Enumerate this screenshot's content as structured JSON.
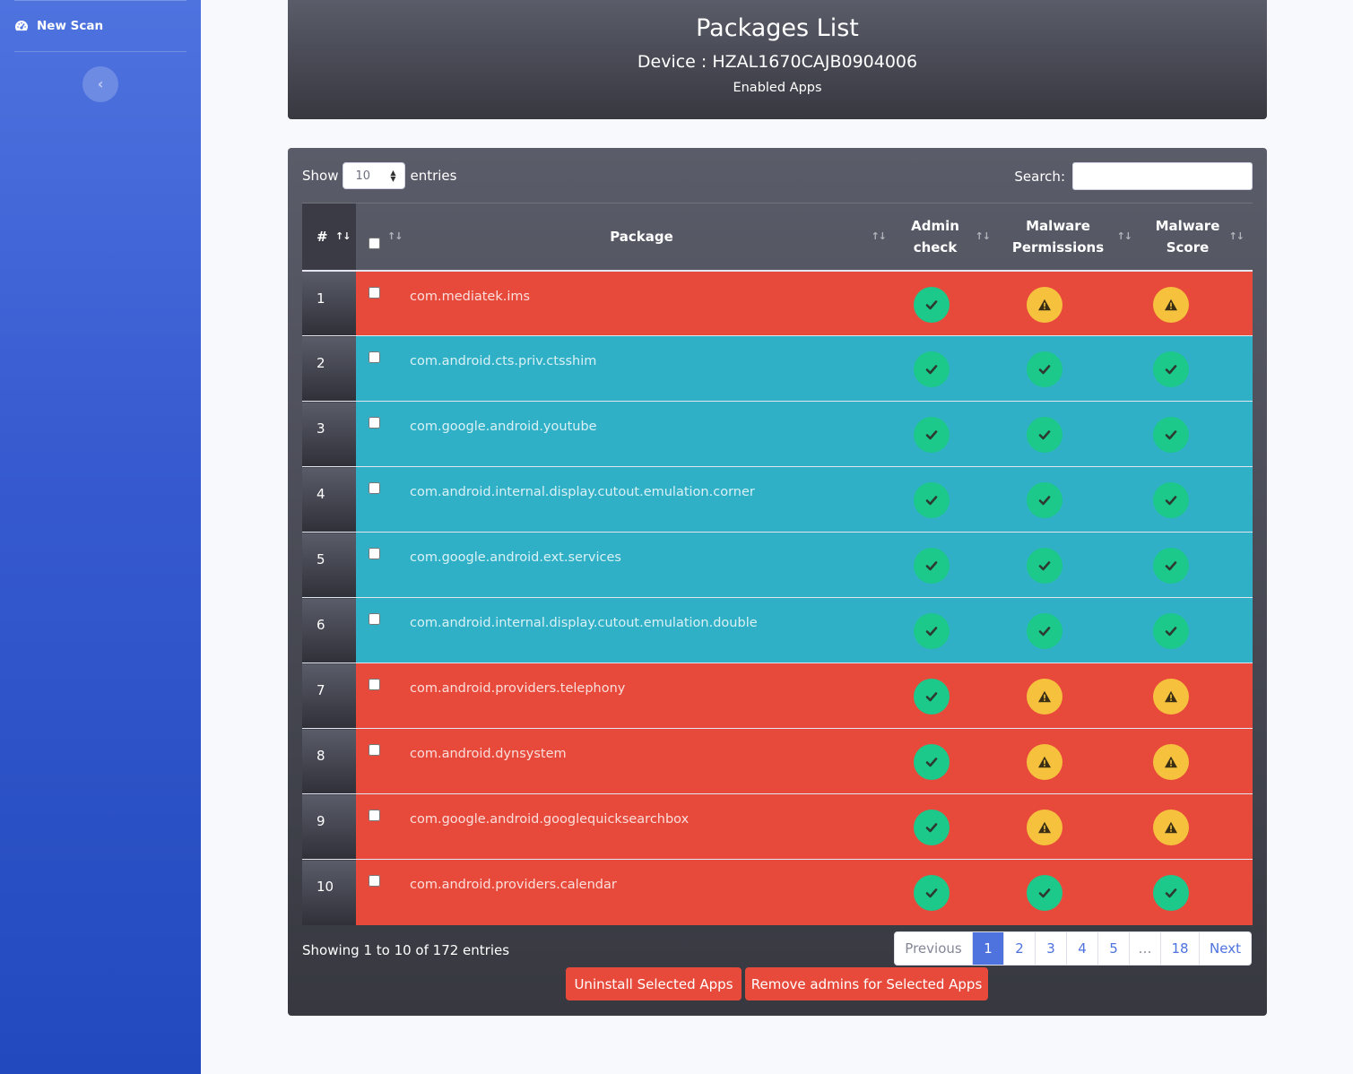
{
  "sidebar": {
    "new_scan_label": "New Scan",
    "new_scan_icon": "tachometer-icon",
    "toggle_icon": "chevron-left-icon",
    "toggle_glyph": "‹"
  },
  "header": {
    "title": "Packages List",
    "device": "Device : HZAL1670CAJB0904006",
    "subtitle": "Enabled Apps"
  },
  "controls": {
    "show_label": "Show",
    "entries_select_value": "10",
    "entries_label": "entries",
    "search_label": "Search:",
    "search_value": ""
  },
  "table": {
    "columns": {
      "number": "#",
      "package": "Package",
      "admin_line1": "Admin",
      "admin_line2": "check",
      "perm_line1": "Malware",
      "perm_line2": "Permissions",
      "score_line1": "Malware",
      "score_line2": "Score"
    },
    "sort_glyph": "↑↓",
    "rows": [
      {
        "num": "1",
        "package": "com.mediatek.ims",
        "status": "danger",
        "admin": "ok",
        "permissions": "warn",
        "score": "warn"
      },
      {
        "num": "2",
        "package": "com.android.cts.priv.ctsshim",
        "status": "info",
        "admin": "ok",
        "permissions": "ok",
        "score": "ok"
      },
      {
        "num": "3",
        "package": "com.google.android.youtube",
        "status": "info",
        "admin": "ok",
        "permissions": "ok",
        "score": "ok"
      },
      {
        "num": "4",
        "package": "com.android.internal.display.cutout.emulation.corner",
        "status": "info",
        "admin": "ok",
        "permissions": "ok",
        "score": "ok"
      },
      {
        "num": "5",
        "package": "com.google.android.ext.services",
        "status": "info",
        "admin": "ok",
        "permissions": "ok",
        "score": "ok"
      },
      {
        "num": "6",
        "package": "com.android.internal.display.cutout.emulation.double",
        "status": "info",
        "admin": "ok",
        "permissions": "ok",
        "score": "ok"
      },
      {
        "num": "7",
        "package": "com.android.providers.telephony",
        "status": "danger",
        "admin": "ok",
        "permissions": "warn",
        "score": "warn"
      },
      {
        "num": "8",
        "package": "com.android.dynsystem",
        "status": "danger",
        "admin": "ok",
        "permissions": "warn",
        "score": "warn"
      },
      {
        "num": "9",
        "package": "com.google.android.googlequicksearchbox",
        "status": "danger",
        "admin": "ok",
        "permissions": "warn",
        "score": "warn"
      },
      {
        "num": "10",
        "package": "com.android.providers.calendar",
        "status": "danger",
        "admin": "ok",
        "permissions": "ok",
        "score": "ok"
      }
    ],
    "status_colors": {
      "danger": "#e74a3b",
      "info": "#30b0c7",
      "ok_badge": "#1cc88a",
      "warn_badge": "#f6c23e"
    }
  },
  "footer": {
    "info": "Showing 1 to 10 of 172 entries",
    "pagination": [
      "Previous",
      "1",
      "2",
      "3",
      "4",
      "5",
      "…",
      "18",
      "Next"
    ],
    "active_page": "1",
    "uninstall_button": "Uninstall Selected Apps",
    "remove_admins_button": "Remove admins for Selected Apps"
  }
}
